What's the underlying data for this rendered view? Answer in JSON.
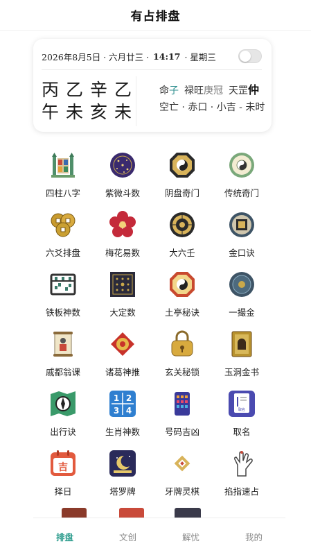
{
  "header": {
    "title": "有占排盘"
  },
  "card": {
    "date": "2026年8月5日 ·",
    "lunar": "六月廿三 ·",
    "time": "14:17",
    "weekday": "· 星期三",
    "pillars_top": [
      "丙",
      "乙",
      "辛",
      "乙"
    ],
    "pillars_bottom": [
      "午",
      "未",
      "亥",
      "未"
    ],
    "ming_label": "命",
    "ming_value": "子",
    "lu": "禄旺",
    "guan": "庚冠",
    "tiangang_prefix": "天罡",
    "tiangang_value": "仲",
    "line2": "空亡 · 赤口 · 小吉 - 未时"
  },
  "grid": [
    {
      "label": "四柱八字",
      "icon": "pagoda-icon"
    },
    {
      "label": "紫微斗数",
      "icon": "star-disc-icon"
    },
    {
      "label": "阴盘奇门",
      "icon": "bagua-yinyang-icon"
    },
    {
      "label": "传统奇门",
      "icon": "jade-disc-icon"
    },
    {
      "label": "六爻排盘",
      "icon": "coins-icon"
    },
    {
      "label": "梅花易数",
      "icon": "plum-blossom-icon"
    },
    {
      "label": "大六壬",
      "icon": "compass-wheel-icon"
    },
    {
      "label": "金口诀",
      "icon": "square-seal-icon"
    },
    {
      "label": "铁板神数",
      "icon": "abacus-icon"
    },
    {
      "label": "大定数",
      "icon": "grid-board-icon"
    },
    {
      "label": "土亭秘诀",
      "icon": "bagua-icon"
    },
    {
      "label": "一撮金",
      "icon": "blue-plate-icon"
    },
    {
      "label": "戚都翁课",
      "icon": "scroll-icon"
    },
    {
      "label": "诸葛神推",
      "icon": "knot-icon"
    },
    {
      "label": "玄关秘锁",
      "icon": "lock-icon"
    },
    {
      "label": "玉洞金书",
      "icon": "book-icon"
    },
    {
      "label": "出行诀",
      "icon": "map-compass-icon"
    },
    {
      "label": "生肖神数",
      "icon": "number-tiles-icon"
    },
    {
      "label": "号码吉凶",
      "icon": "phone-keypad-icon"
    },
    {
      "label": "取名",
      "icon": "name-card-icon"
    },
    {
      "label": "择日",
      "icon": "calendar-icon"
    },
    {
      "label": "塔罗牌",
      "icon": "tarot-icon"
    },
    {
      "label": "牙牌灵棋",
      "icon": "diamond-icon"
    },
    {
      "label": "掐指速占",
      "icon": "hand-icon"
    }
  ],
  "calendar_icon_text": "吉",
  "name_card_text": "取名",
  "number_tiles": [
    "1",
    "2",
    "3",
    "4"
  ],
  "tabs": [
    {
      "label": "排盘",
      "active": true
    },
    {
      "label": "文创",
      "active": false
    },
    {
      "label": "解忧",
      "active": false
    },
    {
      "label": "我的",
      "active": false
    }
  ],
  "colors": {
    "accent": "#2c9c8d",
    "ming": "#2f8f8f"
  }
}
